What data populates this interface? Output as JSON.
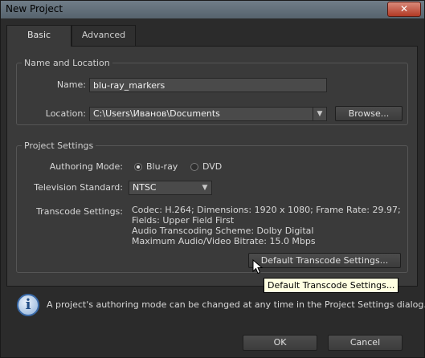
{
  "window": {
    "title": "New Project",
    "close_symbol": "✕"
  },
  "tabs": [
    {
      "label": "Basic",
      "active": true
    },
    {
      "label": "Advanced",
      "active": false
    }
  ],
  "name_location": {
    "group_title": "Name and Location",
    "name_label": "Name:",
    "name_value": "blu-ray_markers",
    "location_label": "Location:",
    "location_value": "C:\\Users\\Иванов\\Documents",
    "browse_label": "Browse..."
  },
  "project_settings": {
    "group_title": "Project Settings",
    "authoring_mode_label": "Authoring Mode:",
    "authoring_options": [
      {
        "label": "Blu-ray",
        "selected": true
      },
      {
        "label": "DVD",
        "selected": false
      }
    ],
    "tv_standard_label": "Television Standard:",
    "tv_standard_value": "NTSC",
    "transcode_label": "Transcode Settings:",
    "transcode_lines": [
      "Codec: H.264; Dimensions: 1920 x 1080; Frame Rate: 29.97;",
      "Fields: Upper Field First",
      "Audio Transcoding Scheme: Dolby Digital",
      "Maximum Audio/Video Bitrate: 15.0 Mbps"
    ],
    "default_transcode_button": "Default Transcode Settings..."
  },
  "tooltip": "Default Transcode Settings...",
  "info": {
    "icon": "info-icon",
    "text": "A project's authoring mode can be changed at any time in the Project Settings dialog."
  },
  "footer": {
    "ok_label": "OK",
    "cancel_label": "Cancel"
  },
  "colors": {
    "dialog_bg": "#2b2b2b",
    "panel_bg": "#3a3a3a",
    "tooltip_bg": "#ffffe1",
    "close_red": "#b23a26"
  }
}
